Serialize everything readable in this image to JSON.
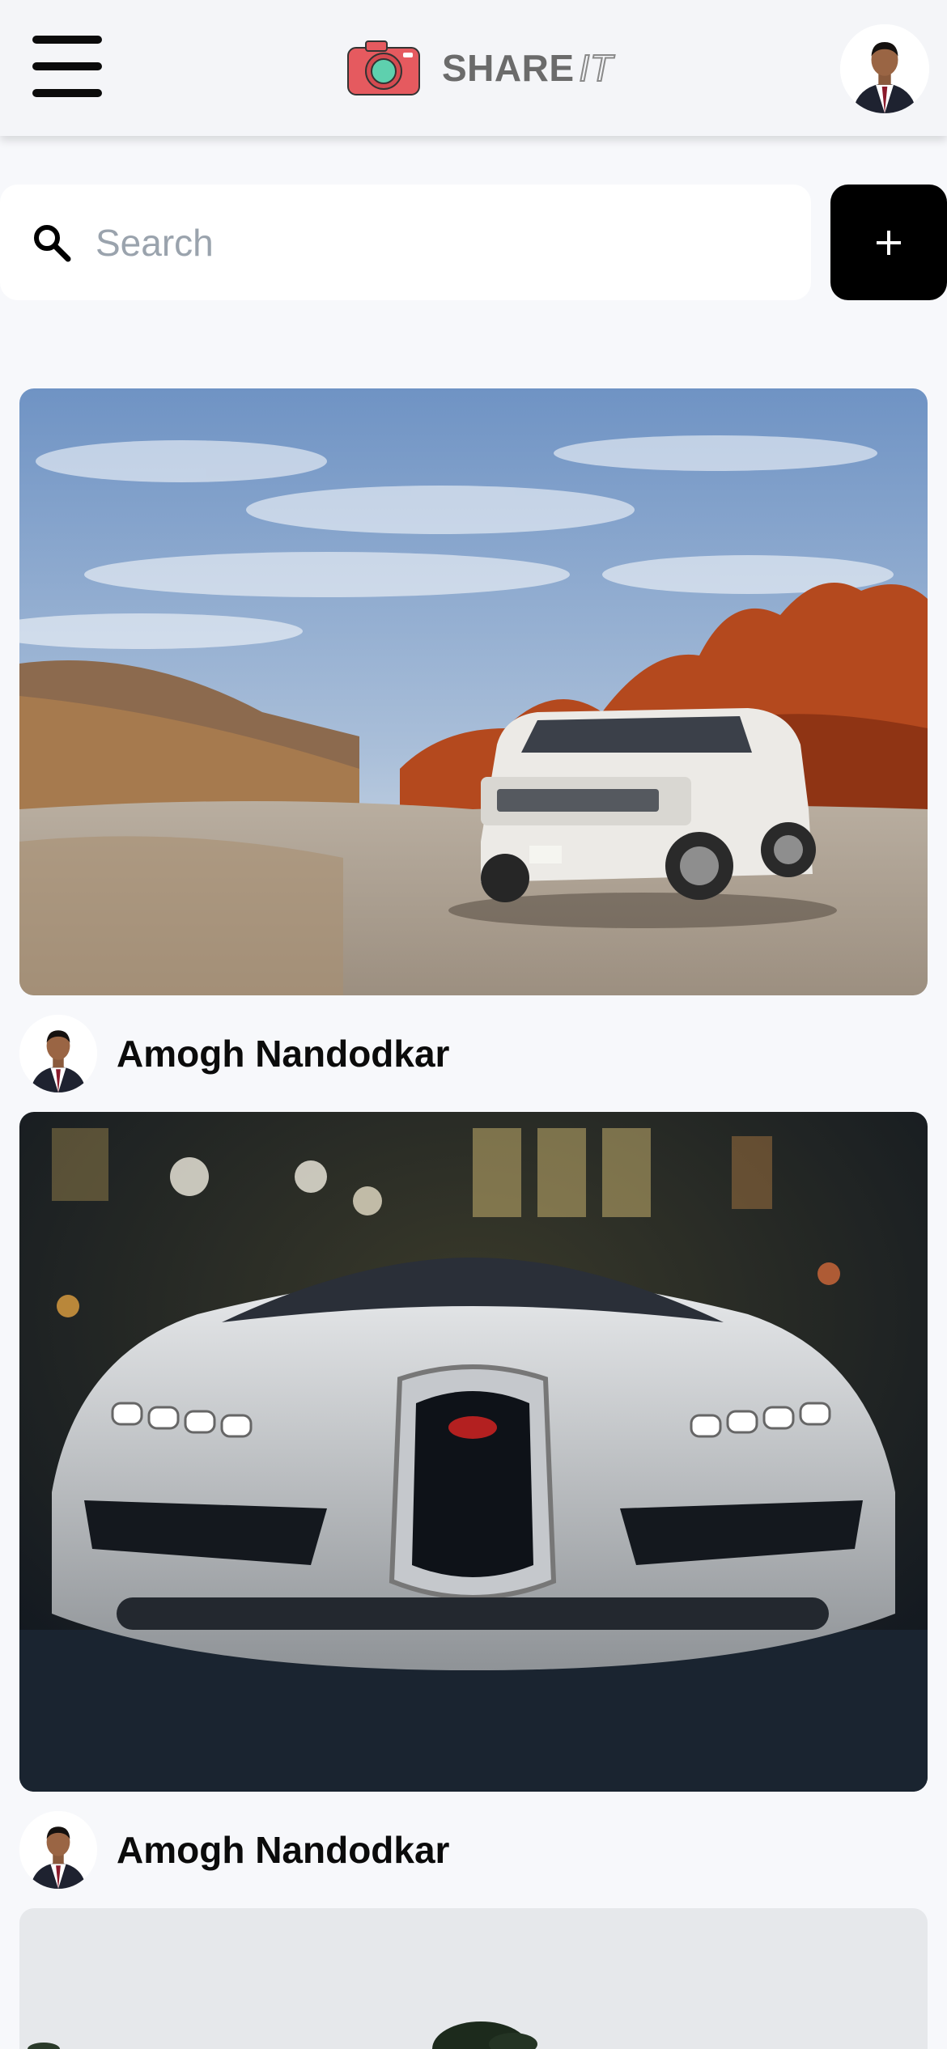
{
  "header": {
    "logo_text": "SHARE",
    "logo_text_suffix": "IT",
    "logo_color": "#e55a5f"
  },
  "search": {
    "placeholder": "Search",
    "value": ""
  },
  "posts": [
    {
      "author": "Amogh Nandodkar",
      "image_subject": "white SUV in desert canyon"
    },
    {
      "author": "Amogh Nandodkar",
      "image_subject": "silver supercar front view at night"
    },
    {
      "author": "",
      "image_subject": "overcast sky with tree tops"
    }
  ],
  "icons": {
    "menu": "hamburger-menu-icon",
    "logo": "camera-icon",
    "search": "search-icon",
    "add": "plus-icon"
  },
  "colors": {
    "accent": "#000000",
    "logo_red": "#e55a5f",
    "logo_teal": "#4fc3a1"
  }
}
